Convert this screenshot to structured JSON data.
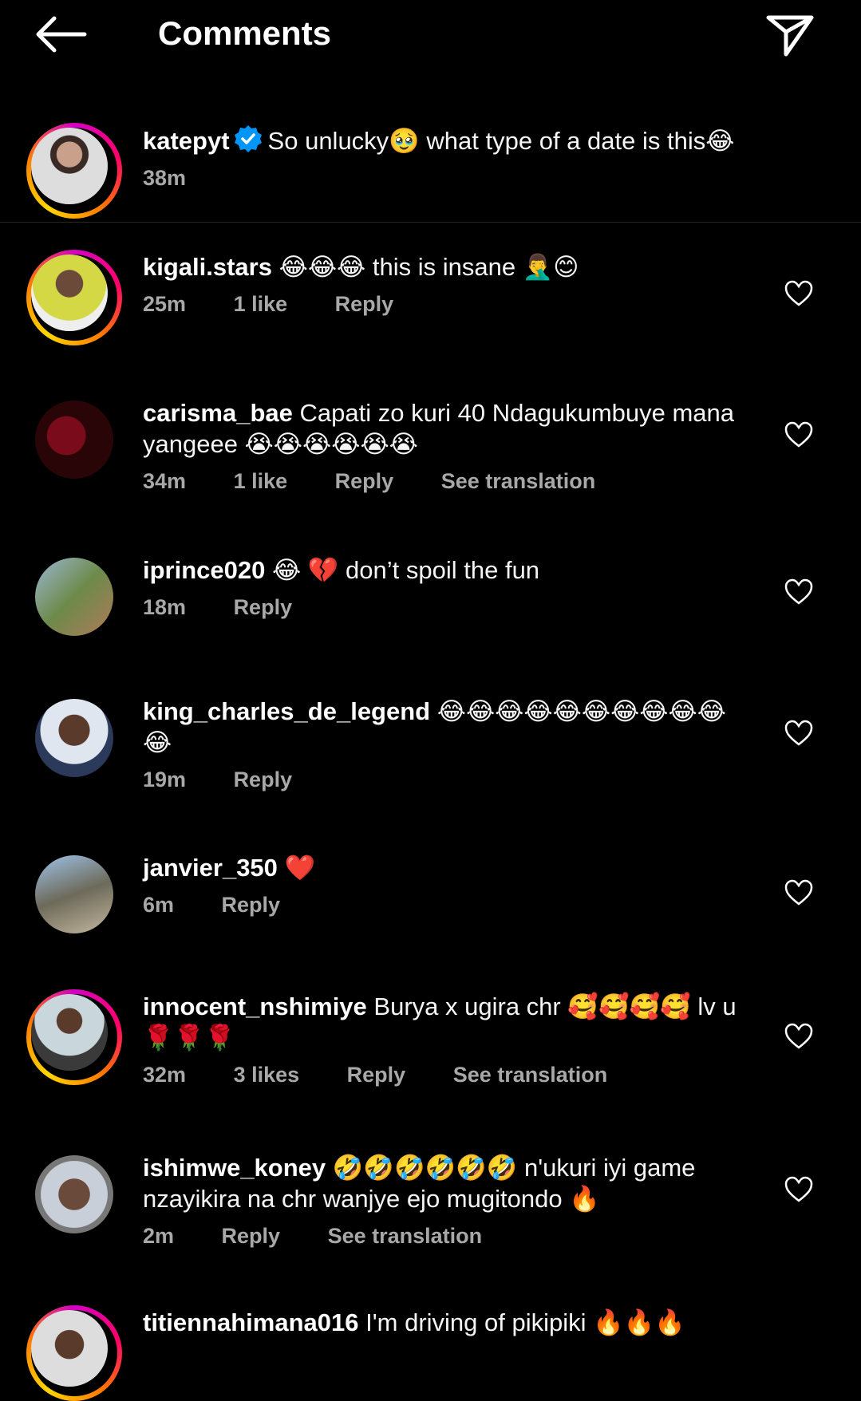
{
  "header": {
    "title": "Comments"
  },
  "caption": {
    "username": "katepyt",
    "text": "So unlucky🥹 what type of a date is this😂",
    "time": "38m"
  },
  "comments": [
    {
      "username": "kigali.stars",
      "text": "😂😂😂 this is insane 🤦‍♂️😊",
      "time": "25m",
      "likes": "1 like",
      "reply": "Reply",
      "translation": ""
    },
    {
      "username": "carisma_bae",
      "text": "Capati zo kuri 40 Ndagukumbuye mana yangeee 😭😭😭😭😭😭",
      "time": "34m",
      "likes": "1 like",
      "reply": "Reply",
      "translation": "See translation"
    },
    {
      "username": "iprince020",
      "text": "😂 💔 don’t spoil the fun",
      "time": "18m",
      "likes": "",
      "reply": "Reply",
      "translation": ""
    },
    {
      "username": "king_charles_de_legend",
      "text": "😂😂😂😂😂😂😂😂😂😂😂",
      "time": "19m",
      "likes": "",
      "reply": "Reply",
      "translation": ""
    },
    {
      "username": "janvier_350",
      "text": "❤️",
      "time": "6m",
      "likes": "",
      "reply": "Reply",
      "translation": ""
    },
    {
      "username": "innocent_nshimiye",
      "text": "Burya x ugira chr 🥰🥰🥰🥰 lv u 🌹🌹🌹",
      "time": "32m",
      "likes": "3 likes",
      "reply": "Reply",
      "translation": "See translation"
    },
    {
      "username": "ishimwe_koney",
      "text": "🤣🤣🤣🤣🤣🤣 n'ukuri iyi game nzayikira na  chr wanjye ejo mugitondo 🔥",
      "time": "2m",
      "likes": "",
      "reply": "Reply",
      "translation": "See translation"
    },
    {
      "username": "titiennahimana016",
      "text": "I'm driving of pikipiki 🔥🔥🔥",
      "time": "",
      "likes": "",
      "reply": "",
      "translation": ""
    }
  ],
  "icons": {
    "back": "arrow-left-icon",
    "send": "paper-plane-icon",
    "verified": "verified-badge-icon",
    "like": "heart-outline-icon"
  },
  "colors": {
    "background": "#000000",
    "meta_text": "#a8a8a8",
    "verified": "#0095f6"
  }
}
